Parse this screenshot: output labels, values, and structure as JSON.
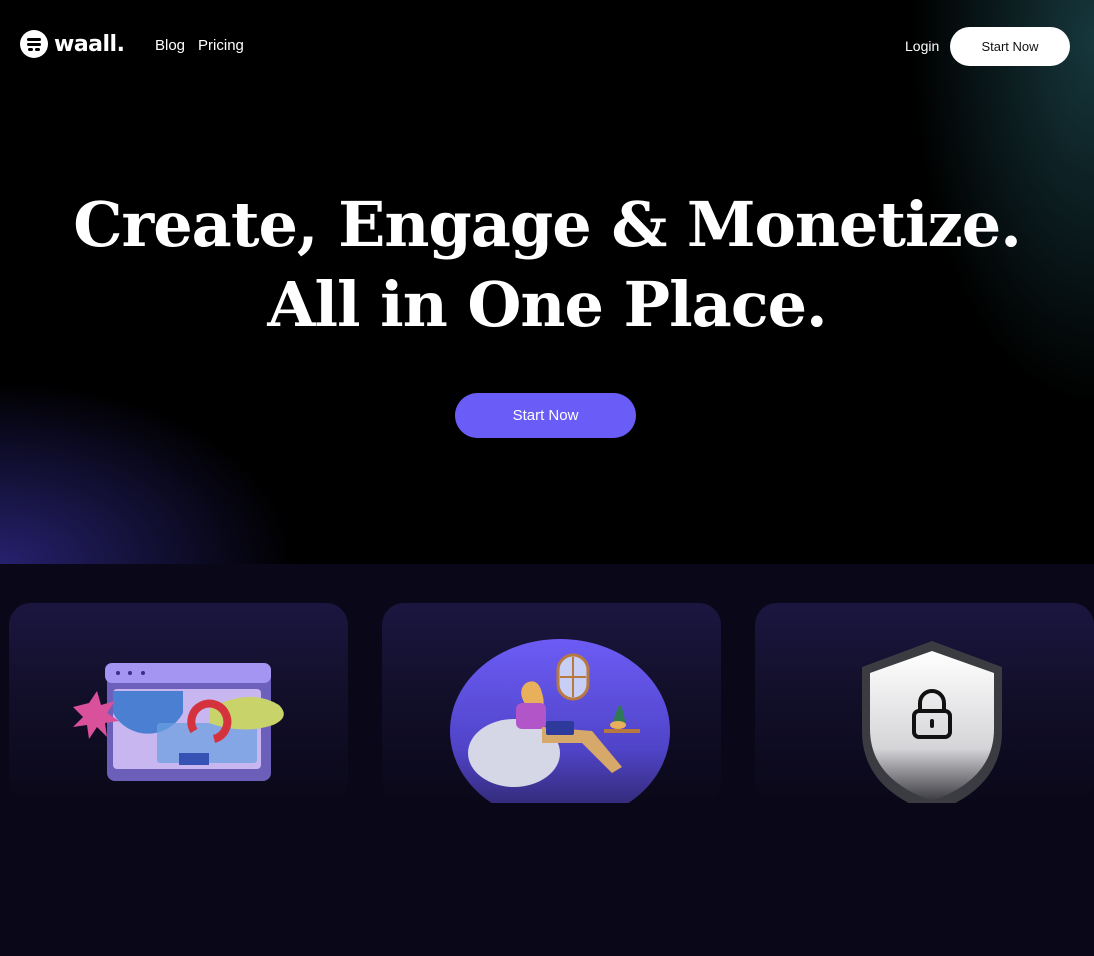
{
  "brand": {
    "name": "waall.",
    "icon": "waall-logo-icon"
  },
  "nav": {
    "links": [
      "Blog",
      "Pricing"
    ],
    "login_label": "Login",
    "cta_label": "Start Now"
  },
  "hero": {
    "headline_line1": "Create, Engage & Monetize.",
    "headline_line2": "All in One Place.",
    "cta_label": "Start Now"
  },
  "features": {
    "cards": [
      {
        "illustration": "browser-magnet-illustration"
      },
      {
        "illustration": "person-laptop-beanbag-illustration"
      },
      {
        "illustration": "shield-lock-icon"
      }
    ]
  },
  "colors": {
    "accent": "#6a5cf6",
    "background": "#000000",
    "section_background": "#0a0818",
    "card_top": "#1b1640"
  }
}
